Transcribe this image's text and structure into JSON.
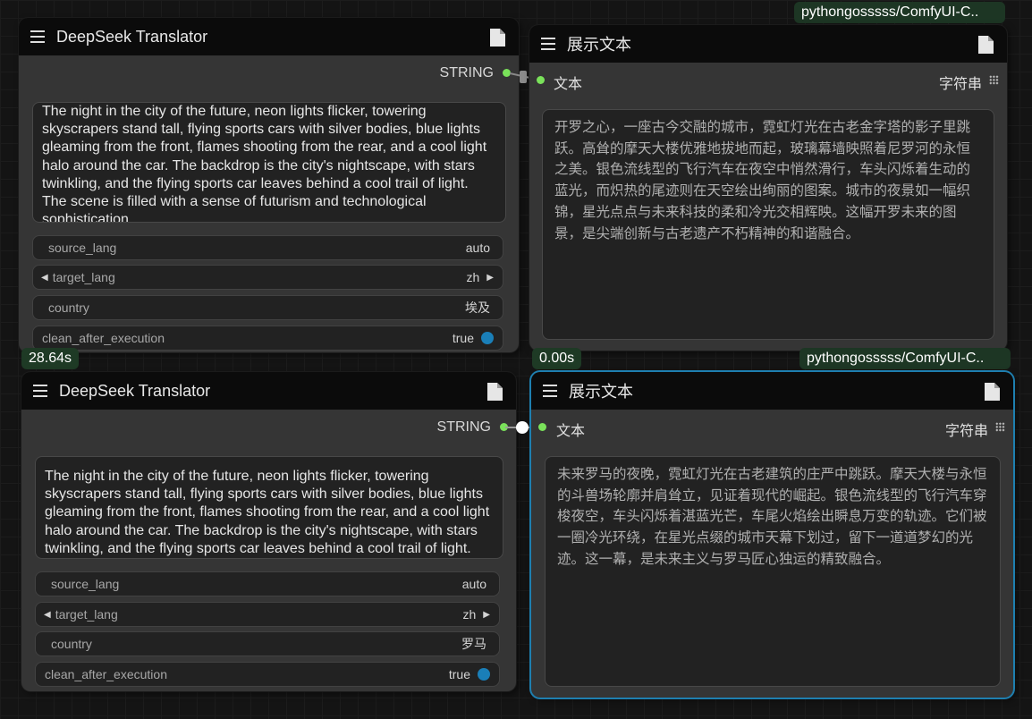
{
  "nodes": {
    "translator1": {
      "title": "DeepSeek Translator",
      "output_label": "STRING",
      "text": "The night in the city of the future, neon lights flicker, towering skyscrapers stand tall, flying sports cars with silver bodies, blue lights gleaming from the front, flames shooting from the rear, and a cool light halo around the car. The backdrop is the city's nightscape, with stars twinkling, and the flying sports car leaves behind a cool trail of light. The scene is filled with a sense of futurism and technological sophistication.",
      "widgets": [
        {
          "name": "source_lang",
          "value": "auto"
        },
        {
          "name": "target_lang",
          "value": "zh"
        },
        {
          "name": "country",
          "value": "埃及"
        },
        {
          "name": "clean_after_execution",
          "value": "true"
        }
      ],
      "exec_time": "28.64s"
    },
    "show1": {
      "title": "展示文本",
      "badge": "pythongosssss/ComfyUI-C..",
      "input_label": "文本",
      "type_label": "字符串",
      "text": "开罗之心，一座古今交融的城市，霓虹灯光在古老金字塔的影子里跳跃。高耸的摩天大楼优雅地拔地而起，玻璃幕墙映照着尼罗河的永恒之美。银色流线型的飞行汽车在夜空中悄然滑行，车头闪烁着生动的蓝光，而炽热的尾迹则在天空绘出绚丽的图案。城市的夜景如一幅织锦，星光点点与未来科技的柔和冷光交相辉映。这幅开罗未来的图景，是尖端创新与古老遗产不朽精神的和谐融合。",
      "exec_time": "0.00s"
    },
    "translator2": {
      "title": "DeepSeek Translator",
      "output_label": "STRING",
      "text": "The night in the city of the future, neon lights flicker, towering skyscrapers stand tall, flying sports cars with silver bodies, blue lights gleaming from the front, flames shooting from the rear, and a cool light halo around the car. The backdrop is the city's nightscape, with stars twinkling, and the flying sports car leaves behind a cool trail of light. The scene is filled with a sense of futurism and technological sophistication.",
      "widgets": [
        {
          "name": "source_lang",
          "value": "auto"
        },
        {
          "name": "target_lang",
          "value": "zh"
        },
        {
          "name": "country",
          "value": "罗马"
        },
        {
          "name": "clean_after_execution",
          "value": "true"
        }
      ]
    },
    "show2": {
      "title": "展示文本",
      "badge": "pythongosssss/ComfyUI-C..",
      "input_label": "文本",
      "type_label": "字符串",
      "text": "未来罗马的夜晚，霓虹灯光在古老建筑的庄严中跳跃。摩天大楼与永恒的斗兽场轮廓并肩耸立，见证着现代的崛起。银色流线型的飞行汽车穿梭夜空，车头闪烁着湛蓝光芒，车尾火焰绘出瞬息万变的轨迹。它们被一圈冷光环绕，在星光点缀的城市天幕下划过，留下一道道梦幻的光迹。这一幕，是未来主义与罗马匠心独运的精致融合。"
    }
  },
  "colors": {
    "accent": "#1a7fb8",
    "slot_green": "#7ae25a",
    "badge_bg": "#1d3624",
    "header_bg": "#0b0b0b",
    "node_bg": "#353535"
  },
  "icons": [
    "hamburger-menu-icon",
    "document-icon",
    "grid-dots-icon",
    "chevron-left-icon",
    "chevron-right-icon"
  ]
}
